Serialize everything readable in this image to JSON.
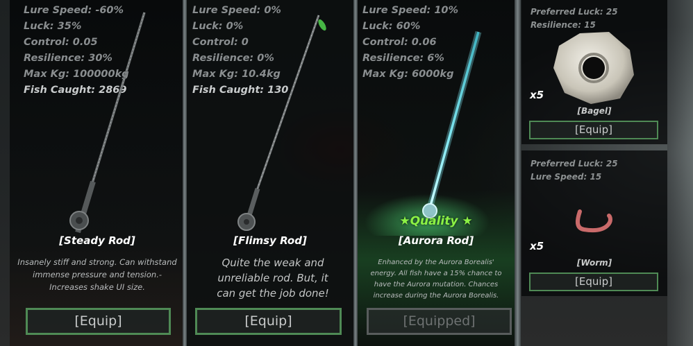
{
  "rods": [
    {
      "stats": [
        "Lure Speed: -60%",
        "Luck: 35%",
        "Control: 0.05",
        "Resilience: 30%",
        "Max Kg: 100000kg",
        "Fish Caught: 2869"
      ],
      "name": "[Steady Rod]",
      "description": "Insanely stiff and strong. Can withstand immense pressure and tension.- Increases shake UI size.",
      "button": "[Equip]"
    },
    {
      "stats": [
        "Lure Speed: 0%",
        "Luck: 0%",
        "Control: 0",
        "Resilience: 0%",
        "Max Kg: 10.4kg",
        "Fish Caught: 130"
      ],
      "name": "[Flimsy Rod]",
      "description": "Quite the weak and unreliable rod. But, it can get the job done!",
      "button": "[Equip]"
    },
    {
      "stats": [
        "Lure Speed: 10%",
        "Luck: 60%",
        "Control: 0.06",
        "Resilience: 6%",
        "Max Kg: 6000kg"
      ],
      "quality": "★Quality ★",
      "name": "[Aurora Rod]",
      "description": "Enhanced by the Aurora Borealis' energy. All fish have a 15% chance to have the Aurora mutation. Chances increase during the Aurora Borealis.",
      "button": "[Equipped]"
    }
  ],
  "baits": [
    {
      "stats": [
        "Preferred Luck: 25",
        "Resilience: 15"
      ],
      "quantity": "x5",
      "name": "[Bagel]",
      "button": "[Equip]"
    },
    {
      "stats": [
        "Preferred Luck: 25",
        "Lure Speed: 15"
      ],
      "quantity": "x5",
      "name": "[Worm]",
      "button": "[Equip]"
    }
  ],
  "colors": {
    "equip_border": "#4f8a55",
    "quality_green": "#8cf244",
    "aurora_glow": "#7fe6f0"
  }
}
